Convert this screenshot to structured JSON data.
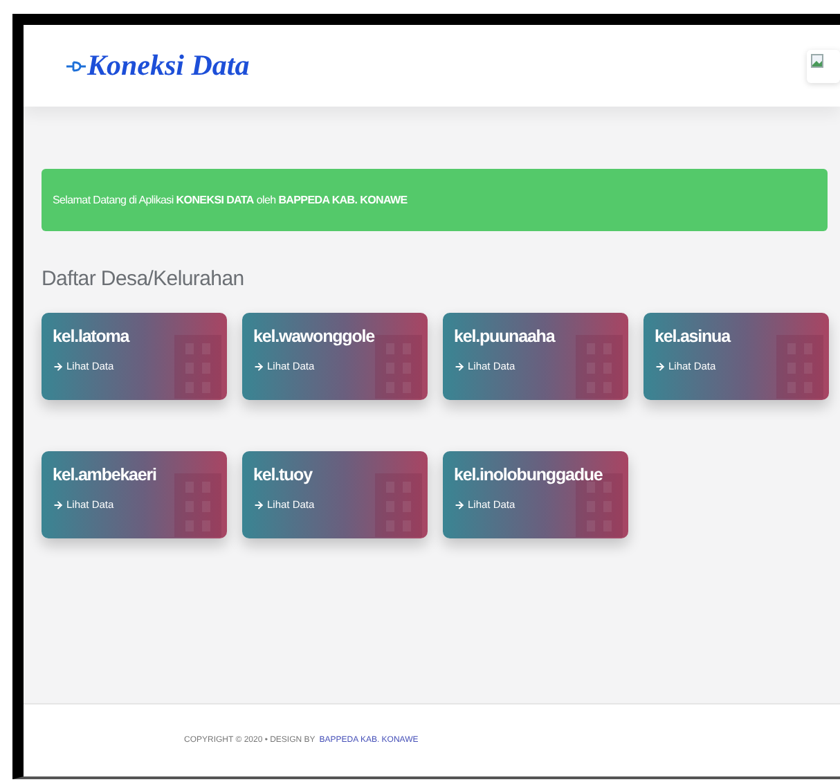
{
  "header": {
    "logo": "Koneksi Data"
  },
  "alert": {
    "text": "Selamat Datang di Aplikasi **KONEKSI DATA** oleh **BAPPEDA KAB. KONAWE**"
  },
  "section_title": "Daftar Desa/Kelurahan",
  "cards": [
    {
      "title": "kel.latoma",
      "link": "Lihat Data"
    },
    {
      "title": "kel.wawonggole",
      "link": "Lihat Data"
    },
    {
      "title": "kel.puunaaha",
      "link": "Lihat Data"
    },
    {
      "title": "kel.asinua",
      "link": "Lihat Data"
    },
    {
      "title": "kel.ambekaeri",
      "link": "Lihat Data"
    },
    {
      "title": "kel.tuoy",
      "link": "Lihat Data"
    },
    {
      "title": "kel.inolobunggadue",
      "link": "Lihat Data"
    }
  ],
  "footer": {
    "text": "COPYRIGHT © 2020  •  DESIGN BY",
    "link": "BAPPEDA KAB. KONAWE"
  }
}
